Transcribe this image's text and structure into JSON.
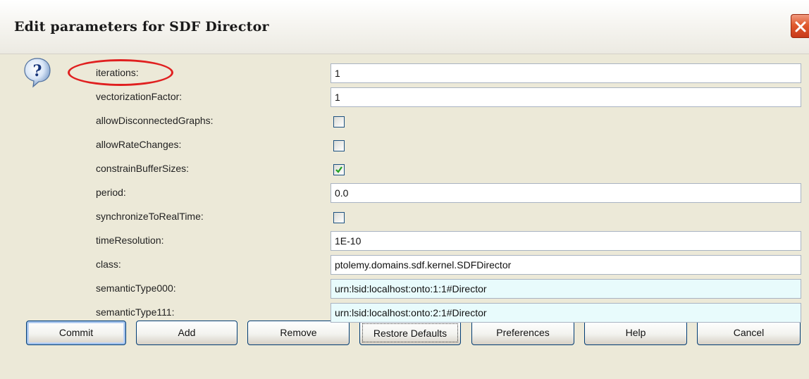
{
  "window": {
    "title": "Edit parameters for SDF Director"
  },
  "params": [
    {
      "name": "iterations:",
      "type": "text",
      "value": "1"
    },
    {
      "name": "vectorizationFactor:",
      "type": "text",
      "value": "1"
    },
    {
      "name": "allowDisconnectedGraphs:",
      "type": "checkbox",
      "checked": false
    },
    {
      "name": "allowRateChanges:",
      "type": "checkbox",
      "checked": false
    },
    {
      "name": "constrainBufferSizes:",
      "type": "checkbox",
      "checked": true
    },
    {
      "name": "period:",
      "type": "text",
      "value": "0.0"
    },
    {
      "name": "synchronizeToRealTime:",
      "type": "checkbox",
      "checked": false
    },
    {
      "name": "timeResolution:",
      "type": "text",
      "value": "1E-10"
    },
    {
      "name": "class:",
      "type": "text",
      "value": "ptolemy.domains.sdf.kernel.SDFDirector"
    },
    {
      "name": "semanticType000:",
      "type": "text",
      "value": "urn:lsid:localhost:onto:1:1#Director",
      "highlight": true
    },
    {
      "name": "semanticType111:",
      "type": "text",
      "value": "urn:lsid:localhost:onto:2:1#Director",
      "highlight": true
    }
  ],
  "buttons": {
    "commit": "Commit",
    "add": "Add",
    "remove": "Remove",
    "restore_defaults": "Restore Defaults",
    "preferences": "Preferences",
    "help": "Help",
    "cancel": "Cancel"
  },
  "icons": {
    "help": "question-bubble-icon",
    "close": "close-icon",
    "check": "checkmark-icon"
  },
  "colors": {
    "highlight_ellipse": "#e02020",
    "check_mark": "#21a121",
    "close_button": "#e05a2f"
  }
}
